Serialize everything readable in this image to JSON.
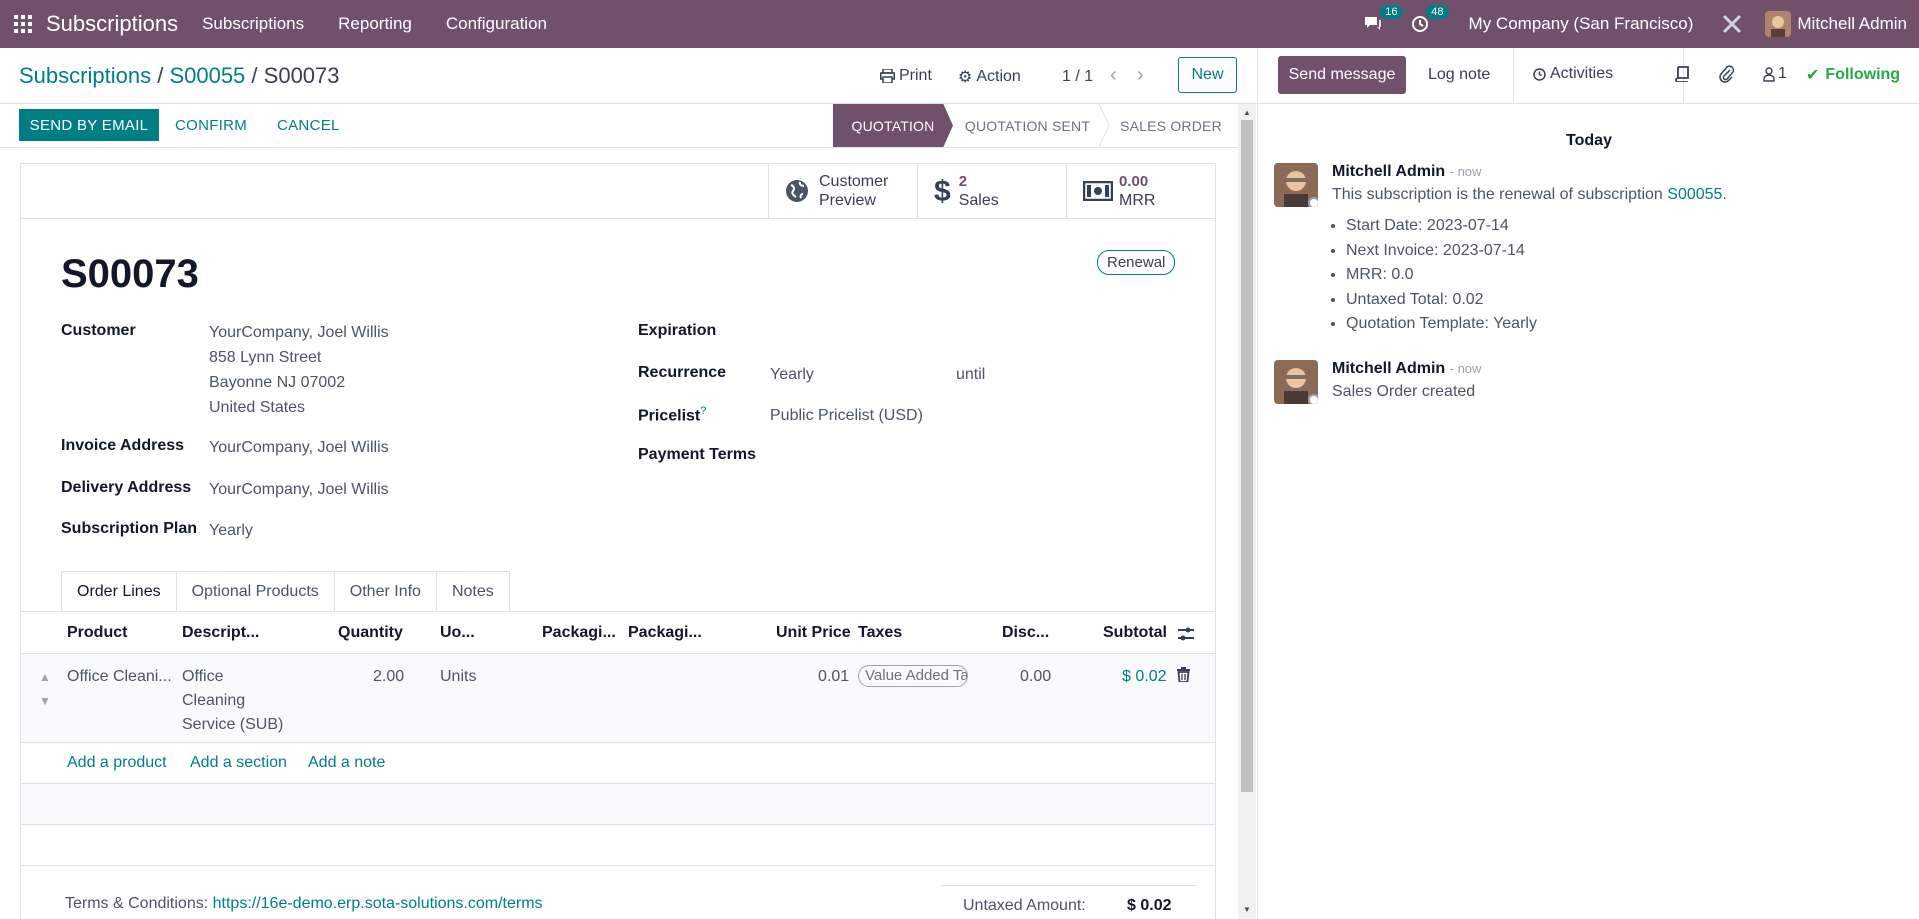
{
  "navbar": {
    "brand": "Subscriptions",
    "menu": [
      "Subscriptions",
      "Reporting",
      "Configuration"
    ],
    "chat_count": "16",
    "activity_count": "48",
    "company": "My Company (San Francisco)",
    "user": "Mitchell Admin"
  },
  "breadcrumb": {
    "root": "Subscriptions",
    "parent": "S00055",
    "current": "S00073"
  },
  "control": {
    "print": "Print",
    "action": "Action",
    "pager": "1 / 1",
    "new": "New"
  },
  "actions": {
    "send_email": "SEND BY EMAIL",
    "confirm": "CONFIRM",
    "cancel": "CANCEL"
  },
  "stages": [
    "QUOTATION",
    "QUOTATION SENT",
    "SALES ORDER"
  ],
  "stat_buttons": {
    "preview_line1": "Customer",
    "preview_line2": "Preview",
    "sales_value": "2",
    "sales_label": "Sales",
    "mrr_value": "0.00",
    "mrr_label": "MRR"
  },
  "record": {
    "name": "S00073",
    "badge": "Renewal",
    "customer_label": "Customer",
    "customer_lines": [
      "YourCompany, Joel Willis",
      "858 Lynn Street",
      "Bayonne NJ 07002",
      "United States"
    ],
    "invoice_label": "Invoice Address",
    "invoice_value": "YourCompany, Joel Willis",
    "delivery_label": "Delivery Address",
    "delivery_value": "YourCompany, Joel Willis",
    "plan_label": "Subscription Plan",
    "plan_value": "Yearly",
    "expiration_label": "Expiration",
    "recurrence_label": "Recurrence",
    "recurrence_value": "Yearly",
    "until": "until",
    "pricelist_label": "Pricelist",
    "pricelist_help": "?",
    "pricelist_value": "Public Pricelist (USD)",
    "payment_label": "Payment Terms"
  },
  "tabs": [
    "Order Lines",
    "Optional Products",
    "Other Info",
    "Notes"
  ],
  "table": {
    "headers": [
      "Product",
      "Descript...",
      "Quantity",
      "Uo...",
      "Packagi...",
      "Packagi...",
      "Unit Price",
      "Taxes",
      "Disc...",
      "Subtotal"
    ],
    "row": {
      "product": "Office Cleani...",
      "description": [
        "Office",
        "Cleaning",
        "Service (SUB)"
      ],
      "quantity": "2.00",
      "uom": "Units",
      "unit_price": "0.01",
      "tax": "Value Added Ta",
      "discount": "0.00",
      "subtotal": "$ 0.02"
    },
    "add_product": "Add a product",
    "add_section": "Add a section",
    "add_note": "Add a note"
  },
  "footer": {
    "terms_label": "Terms & Conditions:",
    "terms_url": "https://16e-demo.erp.sota-solutions.com/terms",
    "untaxed_label": "Untaxed Amount:",
    "untaxed_value": "$ 0.02"
  },
  "chatter": {
    "send_message": "Send message",
    "log_note": "Log note",
    "activities": "Activities",
    "followers_count": "1",
    "following": "Following",
    "today": "Today",
    "messages": [
      {
        "author": "Mitchell Admin",
        "time": "- now",
        "body_prefix": "This subscription is the renewal of subscription",
        "body_link": "S00055",
        "body_suffix": ".",
        "items": [
          "Start Date: 2023-07-14",
          "Next Invoice: 2023-07-14",
          "MRR: 0.0",
          "Untaxed Total: 0.02",
          "Quotation Template: Yearly"
        ]
      },
      {
        "author": "Mitchell Admin",
        "time": "- now",
        "body": "Sales Order created"
      }
    ]
  }
}
